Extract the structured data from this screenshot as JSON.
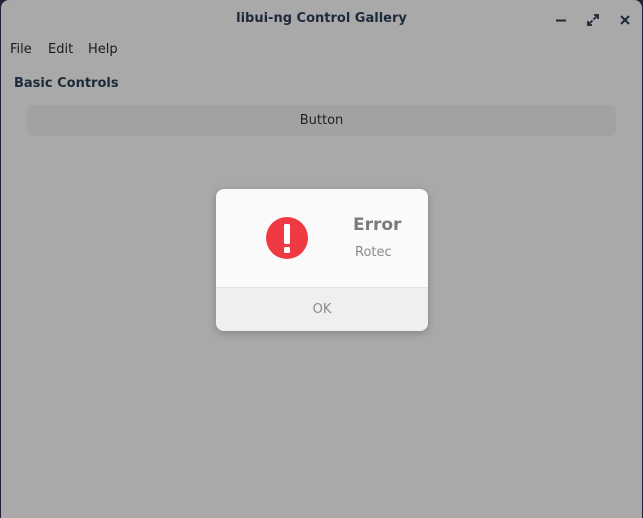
{
  "window": {
    "title": "libui-ng Control Gallery",
    "controls": {
      "minimize_icon": "minimize-icon",
      "maximize_icon": "maximize-icon",
      "close_icon": "close-icon"
    }
  },
  "menubar": {
    "items": [
      {
        "label": "File"
      },
      {
        "label": "Edit"
      },
      {
        "label": "Help"
      }
    ]
  },
  "main": {
    "group_label": "Basic Controls",
    "button_label": "Button"
  },
  "dialog": {
    "icon": "error-icon",
    "icon_color": "#ef3a44",
    "title": "Error",
    "message": "Rotec",
    "ok_label": "OK"
  }
}
